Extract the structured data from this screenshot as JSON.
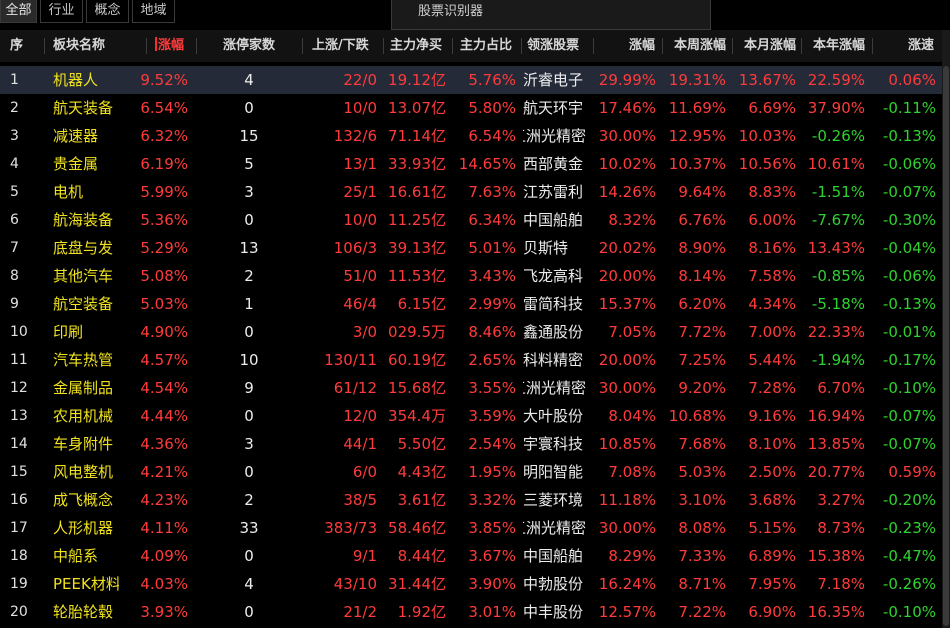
{
  "tabs": [
    {
      "label": "全部",
      "active": true
    },
    {
      "label": "行业",
      "active": false
    },
    {
      "label": "概念",
      "active": false
    },
    {
      "label": "地域",
      "active": false
    }
  ],
  "tool_tab": {
    "label": "股票识别器"
  },
  "columns": {
    "idx": "序",
    "name": "板块名称",
    "chg": "涨幅",
    "limit": "涨停家数",
    "updown": "上涨/下跌",
    "net": "主力净买",
    "ratio": "主力占比",
    "lead": "领涨股票",
    "lead_chg": "涨幅",
    "week": "本周涨幅",
    "month": "本月涨幅",
    "year": "本年涨幅",
    "speed": "涨速"
  },
  "rows": [
    {
      "idx": "1",
      "name": "机器人",
      "chg": "9.52%",
      "limit": "4",
      "updown": "22/0",
      "net": "19.12亿",
      "ratio": "5.76%",
      "lead": "沂睿电子",
      "lead_chg": "29.99%",
      "week": "19.31%",
      "month": "13.67%",
      "year": "22.59%",
      "speed": "0.06%"
    },
    {
      "idx": "2",
      "name": "航天装备",
      "chg": "6.54%",
      "limit": "0",
      "updown": "10/0",
      "net": "13.07亿",
      "ratio": "5.80%",
      "lead": "航天环宇",
      "lead_chg": "17.46%",
      "week": "11.69%",
      "month": "6.69%",
      "year": "37.90%",
      "speed": "-0.11%"
    },
    {
      "idx": "3",
      "name": "减速器",
      "chg": "6.32%",
      "limit": "15",
      "updown": "132/6",
      "net": "71.14亿",
      "ratio": "6.54%",
      "lead": "五洲光精密",
      "lead_chg": "30.00%",
      "week": "12.95%",
      "month": "10.03%",
      "year": "-0.26%",
      "speed": "-0.13%"
    },
    {
      "idx": "4",
      "name": "贵金属",
      "chg": "6.19%",
      "limit": "5",
      "updown": "13/1",
      "net": "33.93亿",
      "ratio": "14.65%",
      "lead": "西部黄金",
      "lead_chg": "10.02%",
      "week": "10.37%",
      "month": "10.56%",
      "year": "10.61%",
      "speed": "-0.06%"
    },
    {
      "idx": "5",
      "name": "电机",
      "chg": "5.99%",
      "limit": "3",
      "updown": "25/1",
      "net": "16.61亿",
      "ratio": "7.63%",
      "lead": "江苏雷利",
      "lead_chg": "14.26%",
      "week": "9.64%",
      "month": "8.83%",
      "year": "-1.51%",
      "speed": "-0.07%"
    },
    {
      "idx": "6",
      "name": "航海装备",
      "chg": "5.36%",
      "limit": "0",
      "updown": "10/0",
      "net": "11.25亿",
      "ratio": "6.34%",
      "lead": "中国船舶",
      "lead_chg": "8.32%",
      "week": "6.76%",
      "month": "6.00%",
      "year": "-7.67%",
      "speed": "-0.30%"
    },
    {
      "idx": "7",
      "name": "底盘与发",
      "chg": "5.29%",
      "limit": "13",
      "updown": "106/3",
      "net": "39.13亿",
      "ratio": "5.01%",
      "lead": "贝斯特",
      "lead_chg": "20.02%",
      "week": "8.90%",
      "month": "8.16%",
      "year": "13.43%",
      "speed": "-0.04%"
    },
    {
      "idx": "8",
      "name": "其他汽车",
      "chg": "5.08%",
      "limit": "2",
      "updown": "51/0",
      "net": "11.53亿",
      "ratio": "3.43%",
      "lead": "飞龙高科",
      "lead_chg": "20.00%",
      "week": "8.14%",
      "month": "7.58%",
      "year": "-0.85%",
      "speed": "-0.06%"
    },
    {
      "idx": "9",
      "name": "航空装备",
      "chg": "5.03%",
      "limit": "1",
      "updown": "46/4",
      "net": "6.15亿",
      "ratio": "2.99%",
      "lead": "雷简科技",
      "lead_chg": "15.37%",
      "week": "6.20%",
      "month": "4.34%",
      "year": "-5.18%",
      "speed": "-0.13%"
    },
    {
      "idx": "10",
      "name": "印刷",
      "chg": "4.90%",
      "limit": "0",
      "updown": "3/0",
      "net": "029.5万",
      "ratio": "8.46%",
      "lead": "鑫通股份",
      "lead_chg": "7.05%",
      "week": "7.72%",
      "month": "7.00%",
      "year": "22.33%",
      "speed": "-0.01%"
    },
    {
      "idx": "11",
      "name": "汽车热管",
      "chg": "4.57%",
      "limit": "10",
      "updown": "130/11",
      "net": "60.19亿",
      "ratio": "2.65%",
      "lead": "科料精密",
      "lead_chg": "20.00%",
      "week": "7.25%",
      "month": "5.44%",
      "year": "-1.94%",
      "speed": "-0.17%"
    },
    {
      "idx": "12",
      "name": "金属制品",
      "chg": "4.54%",
      "limit": "9",
      "updown": "61/12",
      "net": "15.68亿",
      "ratio": "3.55%",
      "lead": "五洲光精密",
      "lead_chg": "30.00%",
      "week": "9.20%",
      "month": "7.28%",
      "year": "6.70%",
      "speed": "-0.10%"
    },
    {
      "idx": "13",
      "name": "农用机械",
      "chg": "4.44%",
      "limit": "0",
      "updown": "12/0",
      "net": "354.4万",
      "ratio": "3.59%",
      "lead": "大叶股份",
      "lead_chg": "8.04%",
      "week": "10.68%",
      "month": "9.16%",
      "year": "16.94%",
      "speed": "-0.07%"
    },
    {
      "idx": "14",
      "name": "车身附件",
      "chg": "4.36%",
      "limit": "3",
      "updown": "44/1",
      "net": "5.50亿",
      "ratio": "2.54%",
      "lead": "宇寰科技",
      "lead_chg": "10.85%",
      "week": "7.68%",
      "month": "8.10%",
      "year": "13.85%",
      "speed": "-0.07%"
    },
    {
      "idx": "15",
      "name": "风电整机",
      "chg": "4.21%",
      "limit": "0",
      "updown": "6/0",
      "net": "4.43亿",
      "ratio": "1.95%",
      "lead": "明阳智能",
      "lead_chg": "7.08%",
      "week": "5.03%",
      "month": "2.50%",
      "year": "20.77%",
      "speed": "0.59%"
    },
    {
      "idx": "16",
      "name": "成飞概念",
      "chg": "4.23%",
      "limit": "2",
      "updown": "38/5",
      "net": "3.61亿",
      "ratio": "3.32%",
      "lead": "三菱环境",
      "lead_chg": "11.18%",
      "week": "3.10%",
      "month": "3.68%",
      "year": "3.27%",
      "speed": "-0.20%"
    },
    {
      "idx": "17",
      "name": "人形机器",
      "chg": "4.11%",
      "limit": "33",
      "updown": "383/73",
      "net": "58.46亿",
      "ratio": "3.85%",
      "lead": "五洲光精密",
      "lead_chg": "30.00%",
      "week": "8.08%",
      "month": "5.15%",
      "year": "8.73%",
      "speed": "-0.23%"
    },
    {
      "idx": "18",
      "name": "中船系",
      "chg": "4.09%",
      "limit": "0",
      "updown": "9/1",
      "net": "8.44亿",
      "ratio": "3.67%",
      "lead": "中国船舶",
      "lead_chg": "8.29%",
      "week": "7.33%",
      "month": "6.89%",
      "year": "15.38%",
      "speed": "-0.47%"
    },
    {
      "idx": "19",
      "name": "PEEK材料",
      "chg": "4.03%",
      "limit": "4",
      "updown": "43/10",
      "net": "31.44亿",
      "ratio": "3.90%",
      "lead": "中勃股份",
      "lead_chg": "16.24%",
      "week": "8.71%",
      "month": "7.95%",
      "year": "7.18%",
      "speed": "-0.26%"
    },
    {
      "idx": "20",
      "name": "轮胎轮毂",
      "chg": "3.93%",
      "limit": "0",
      "updown": "21/2",
      "net": "1.92亿",
      "ratio": "3.01%",
      "lead": "中丰股份",
      "lead_chg": "12.57%",
      "week": "7.22%",
      "month": "6.90%",
      "year": "16.35%",
      "speed": "-0.10%"
    }
  ],
  "colors": {
    "up": "#ff3b3b",
    "down": "#2fd22f",
    "name": "#f0e21e",
    "selected_row": "#242a38"
  }
}
